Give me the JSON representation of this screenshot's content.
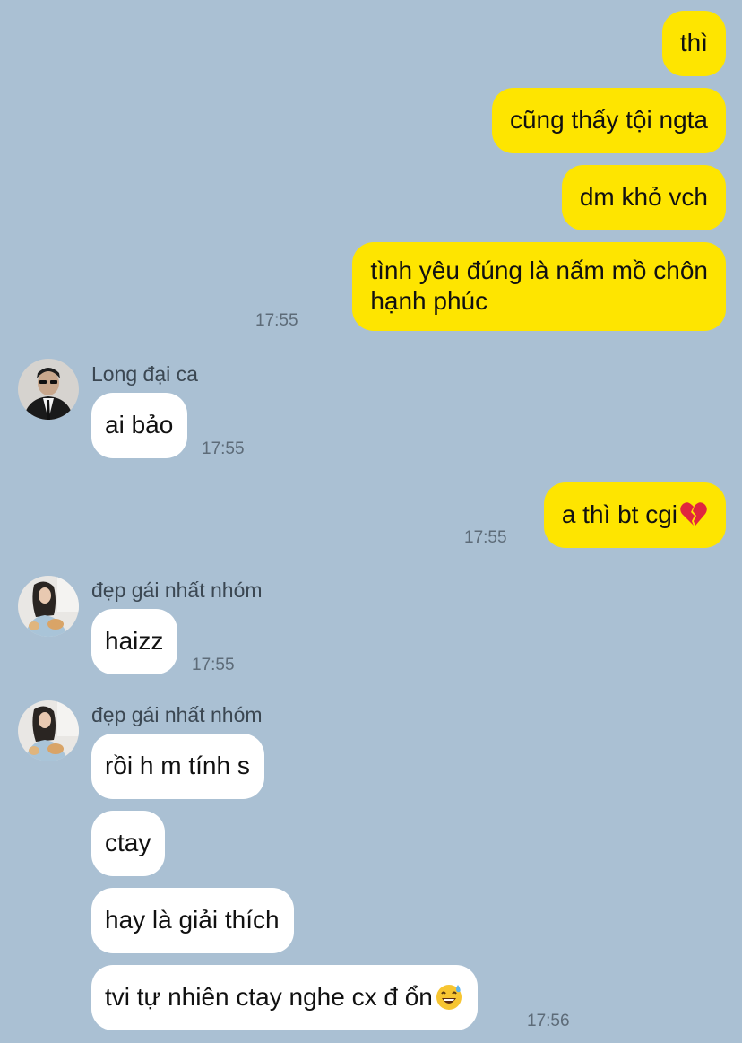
{
  "messages": [
    {
      "text": "thì"
    },
    {
      "text": "cũng thấy tội ngta"
    },
    {
      "text": "dm khỏ vch"
    },
    {
      "text": "tình yêu đúng là nấm mồ chôn",
      "text2": "hạnh phúc",
      "time": "17:55"
    },
    {
      "sender": "Long đại ca",
      "text": "ai bảo",
      "time": "17:55"
    },
    {
      "text": "a thì bt cgi",
      "emoji": "broken-heart-emoji",
      "time": "17:55"
    },
    {
      "sender": "đẹp gái nhất nhóm",
      "text": "haizz",
      "time": "17:55"
    },
    {
      "sender": "đẹp gái nhất nhóm",
      "text": "rồi h m tính s"
    },
    {
      "text": "ctay"
    },
    {
      "text": "hay là giải thích"
    },
    {
      "text": "tvi tự nhiên ctay nghe cx đ ổn",
      "emoji": "sweat-smile-emoji",
      "time": "17:56"
    }
  ],
  "colors": {
    "background": "#aac0d3",
    "outgoing_bubble": "#fee500",
    "incoming_bubble": "#ffffff"
  }
}
